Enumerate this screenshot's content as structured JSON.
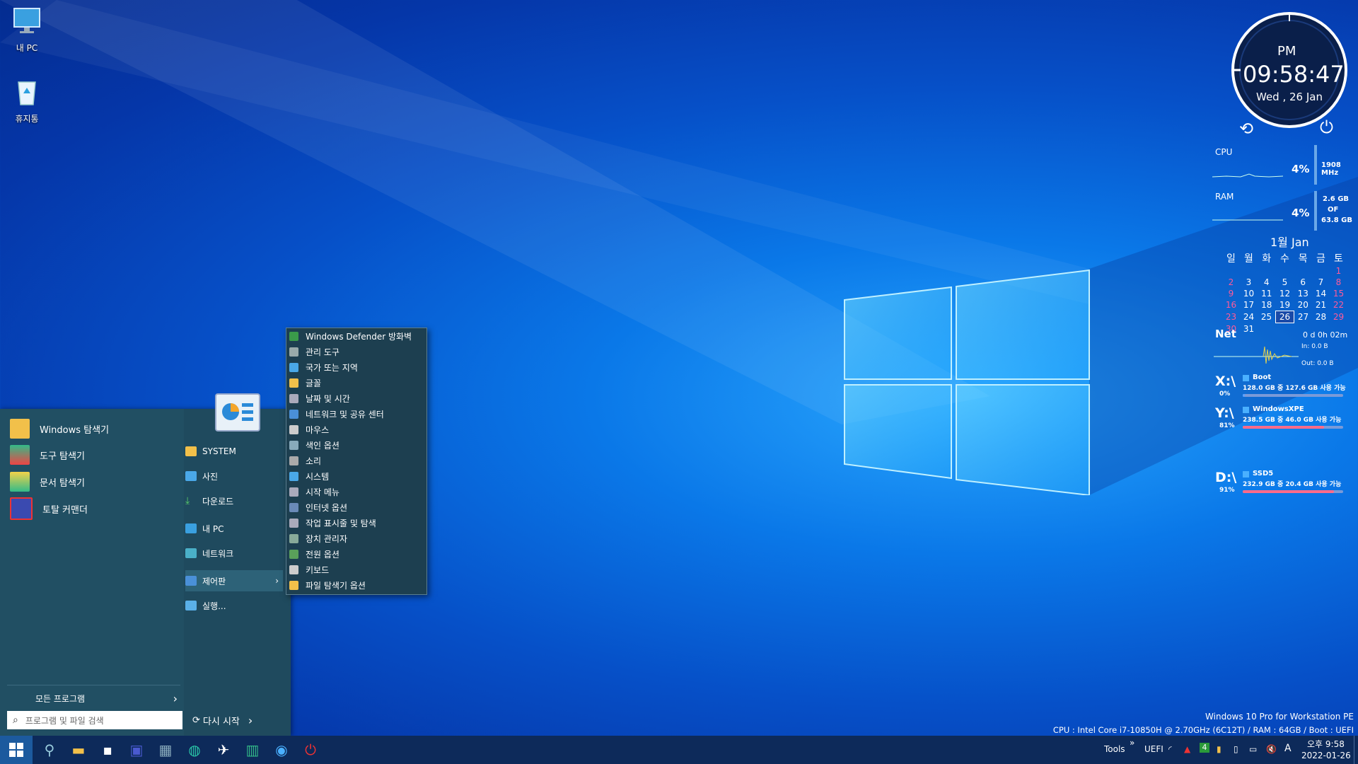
{
  "desktop": {
    "icons": [
      {
        "label": "내 PC",
        "icon": "monitor-icon"
      },
      {
        "label": "휴지통",
        "icon": "recycle-bin-icon"
      }
    ]
  },
  "start_menu": {
    "programs": [
      {
        "label": "Windows 탐색기",
        "icon": "folder-icon"
      },
      {
        "label": "도구 탐색기",
        "icon": "tools-explorer-icon"
      },
      {
        "label": "문서 탐색기",
        "icon": "document-explorer-icon"
      },
      {
        "label": "토탈 커맨더",
        "icon": "floppy-icon"
      }
    ],
    "places": [
      {
        "label": "SYSTEM",
        "icon": "folder-icon"
      },
      {
        "label": "사진",
        "icon": "pictures-icon"
      },
      {
        "label": "다운로드",
        "icon": "download-icon"
      },
      {
        "label": "내 PC",
        "icon": "computer-icon"
      },
      {
        "label": "네트워크",
        "icon": "network-icon"
      },
      {
        "label": "제어판",
        "icon": "control-panel-icon"
      },
      {
        "label": "실행...",
        "icon": "run-icon"
      }
    ],
    "all_programs": "모든 프로그램",
    "search_placeholder": "프로그램 및 파일 검색",
    "restart": "다시 시작"
  },
  "control_panel_submenu": [
    "Windows Defender 방화벽",
    "관리 도구",
    "국가 또는 지역",
    "글꼴",
    "날짜 및 시간",
    "네트워크 및 공유 센터",
    "마우스",
    "색인 옵션",
    "소리",
    "시스템",
    "시작 메뉴",
    "인터넷 옵션",
    "작업 표시줄 및 탐색",
    "장치 관리자",
    "전원 옵션",
    "키보드",
    "파일 탐색기 옵션"
  ],
  "clock": {
    "ampm": "PM",
    "time": "09:58:47",
    "date": "Wed , 26 Jan"
  },
  "monitor": {
    "cpu_label": "CPU",
    "cpu_pct": "4%",
    "cpu_freq": "1908 MHz",
    "ram_label": "RAM",
    "ram_pct": "4%",
    "ram_used": "2.6 GB",
    "ram_of": "OF",
    "ram_total": "63.8 GB"
  },
  "calendar": {
    "title": "1월 Jan",
    "weekdays": [
      "일",
      "월",
      "화",
      "수",
      "목",
      "금",
      "토"
    ],
    "weeks": [
      [
        "",
        "",
        "",
        "",
        "",
        "",
        "1"
      ],
      [
        "2",
        "3",
        "4",
        "5",
        "6",
        "7",
        "8"
      ],
      [
        "9",
        "10",
        "11",
        "12",
        "13",
        "14",
        "15"
      ],
      [
        "16",
        "17",
        "18",
        "19",
        "20",
        "21",
        "22"
      ],
      [
        "23",
        "24",
        "25",
        "26",
        "27",
        "28",
        "29"
      ],
      [
        "30",
        "31",
        "",
        "",
        "",
        "",
        ""
      ]
    ],
    "today": "26"
  },
  "net": {
    "label": "Net",
    "uptime": "0 d 0h 02m",
    "in": "In: 0.0 B",
    "out": "Out: 0.0 B"
  },
  "drives": [
    {
      "letter": "X:\\",
      "name": "Boot",
      "info": "128.0 GB 중 127.6 GB 사용 가능",
      "pct": "0%",
      "used": 0.003,
      "color": "#5aa0ff"
    },
    {
      "letter": "Y:\\",
      "name": "WindowsXPE",
      "info": "238.5 GB 중 46.0 GB 사용 가능",
      "pct": "81%",
      "used": 0.81,
      "color": "#ff6b8a"
    },
    {
      "letter": "D:\\",
      "name": "SSD5",
      "info": "232.9 GB 중 20.4 GB 사용 가능",
      "pct": "91%",
      "used": 0.91,
      "color": "#ff6b8a"
    }
  ],
  "sysinfo": {
    "line1": "Windows 10 Pro for Workstation PE",
    "line2": "CPU : Intel Core i7-10850H @ 2.70GHz (6C12T) / RAM : 64GB / Boot : UEFI"
  },
  "taskbar": {
    "apps": [
      "start-icon",
      "search-icon",
      "file-explorer-icon",
      "terminal-icon",
      "floppy-icon",
      "device-icon",
      "edge-icon",
      "bird-icon",
      "tools-icon",
      "camera-icon",
      "power-icon"
    ],
    "tools_label": "Tools",
    "uefi_label": "UEFI",
    "tray_badge": "4",
    "ime": "A",
    "time": "오후 9:58",
    "date": "2022-01-26"
  }
}
